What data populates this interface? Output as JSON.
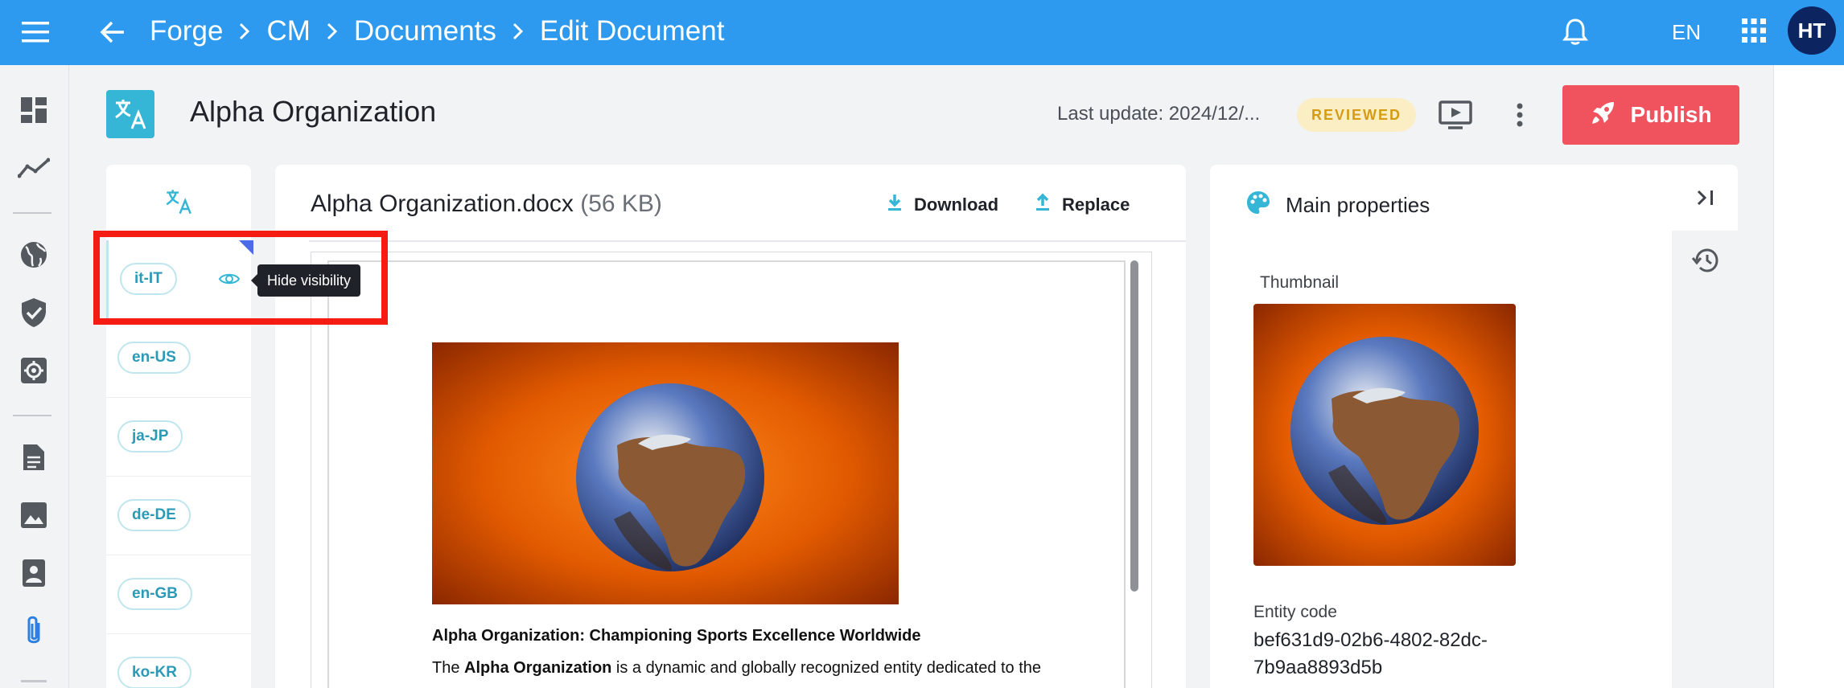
{
  "topbar": {
    "breadcrumbs": [
      "Forge",
      "CM",
      "Documents",
      "Edit Document"
    ],
    "language": "EN",
    "avatar_initials": "HT",
    "color": "#2d9aef"
  },
  "rail": {
    "icons": [
      "dashboard-icon",
      "analytics-icon",
      "globe-icon",
      "shield-check-icon",
      "settings-icon",
      "document-icon",
      "image-icon",
      "portrait-icon",
      "attachment-icon"
    ]
  },
  "header": {
    "title": "Alpha Organization",
    "last_update": "Last update: 2024/12/...",
    "status": "REVIEWED",
    "publish_label": "Publish",
    "publish_color": "#f0525e"
  },
  "locales": {
    "items": [
      "it-IT",
      "en-US",
      "ja-JP",
      "de-DE",
      "en-GB",
      "ko-KR"
    ],
    "active": "it-IT",
    "tooltip": "Hide visibility"
  },
  "document": {
    "file_name": "Alpha Organization.docx",
    "file_size": "(56 KB)",
    "download_label": "Download",
    "replace_label": "Replace",
    "heading": "Alpha Organization: Championing Sports Excellence Worldwide",
    "para_prefix": "The ",
    "para_bold": "Alpha Organization",
    "para_rest": " is a dynamic and globally recognized entity dedicated to the"
  },
  "properties": {
    "title": "Main properties",
    "thumbnail_label": "Thumbnail",
    "entity_code_label": "Entity code",
    "entity_code_line1": "bef631d9-02b6-4802-82dc-",
    "entity_code_line2": "7b9aa8893d5b"
  }
}
